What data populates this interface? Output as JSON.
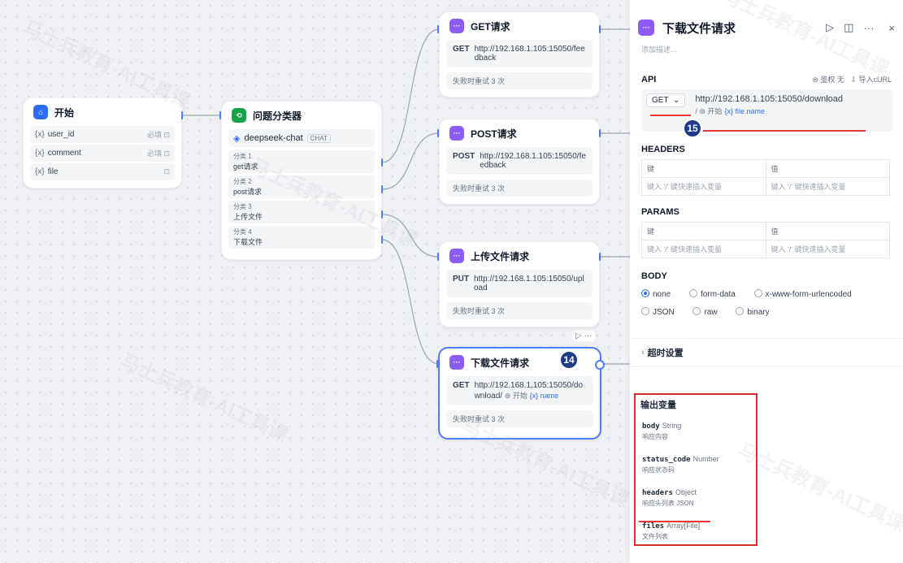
{
  "start": {
    "title": "开始",
    "vars": [
      {
        "name": "user_id",
        "req": "必填 ⊡"
      },
      {
        "name": "comment",
        "req": "必填 ⊡"
      },
      {
        "name": "file",
        "req": "⊡"
      }
    ]
  },
  "classifier": {
    "title": "问题分类器",
    "model": "deepseek-chat",
    "model_tag": "CHAT",
    "classes": [
      {
        "k": "分类 1",
        "v": "get请求"
      },
      {
        "k": "分类 2",
        "v": "post请求"
      },
      {
        "k": "分类 3",
        "v": "上传文件"
      },
      {
        "k": "分类 4",
        "v": "下载文件"
      }
    ]
  },
  "nodes": {
    "get": {
      "title": "GET请求",
      "method": "GET",
      "url": "http://192.168.1.105:15050/feedback",
      "retry": "失败时重试 3 次"
    },
    "post": {
      "title": "POST请求",
      "method": "POST",
      "url": "http://192.168.1.105:15050/feedback",
      "retry": "失败时重试 3 次"
    },
    "upload": {
      "title": "上传文件请求",
      "method": "PUT",
      "url": "http://192.168.1.105:15050/upload",
      "retry": "失败时重试 3 次"
    },
    "download": {
      "title": "下载文件请求",
      "method": "GET",
      "url": "http://192.168.1.105:15050/download/",
      "var_start": "⊜ 开始",
      "var_name": "{x} name",
      "retry": "失败时重试 3 次",
      "actions": "▷ ···"
    }
  },
  "badges": {
    "b14": "14",
    "b15": "15"
  },
  "panel": {
    "title": "下载文件请求",
    "desc": "添加描述...",
    "api_label": "API",
    "auth": "⊜ 鉴权 无",
    "import": "⇩ 导入cURL",
    "method": "GET",
    "method_chevron": "⌄",
    "url": "http://192.168.1.105:15050/download",
    "url_start": "/ ⊜ 开始",
    "url_var": "{x} file.name",
    "headers_label": "HEADERS",
    "params_label": "PARAMS",
    "key": "键",
    "value": "值",
    "placeholder": "键入 '/' 键快速插入变量",
    "body_label": "BODY",
    "body_options": [
      "none",
      "form-data",
      "x-www-form-urlencoded",
      "JSON",
      "raw",
      "binary"
    ],
    "timeout": "超时设置",
    "outputs_label": "输出变量",
    "outputs": [
      {
        "name": "body",
        "type": "String",
        "desc": "响应内容"
      },
      {
        "name": "status_code",
        "type": "Number",
        "desc": "响应状态码"
      },
      {
        "name": "headers",
        "type": "Object",
        "desc": "响应头列表 JSON"
      },
      {
        "name": "files",
        "type": "Array[File]",
        "desc": "文件列表"
      }
    ]
  },
  "watermark": "马士兵教育-AI工具课",
  "colors": {
    "accent": "#2d6cf6",
    "purple": "#8b5cf6",
    "green": "#16a34a",
    "red": "#e53935"
  }
}
